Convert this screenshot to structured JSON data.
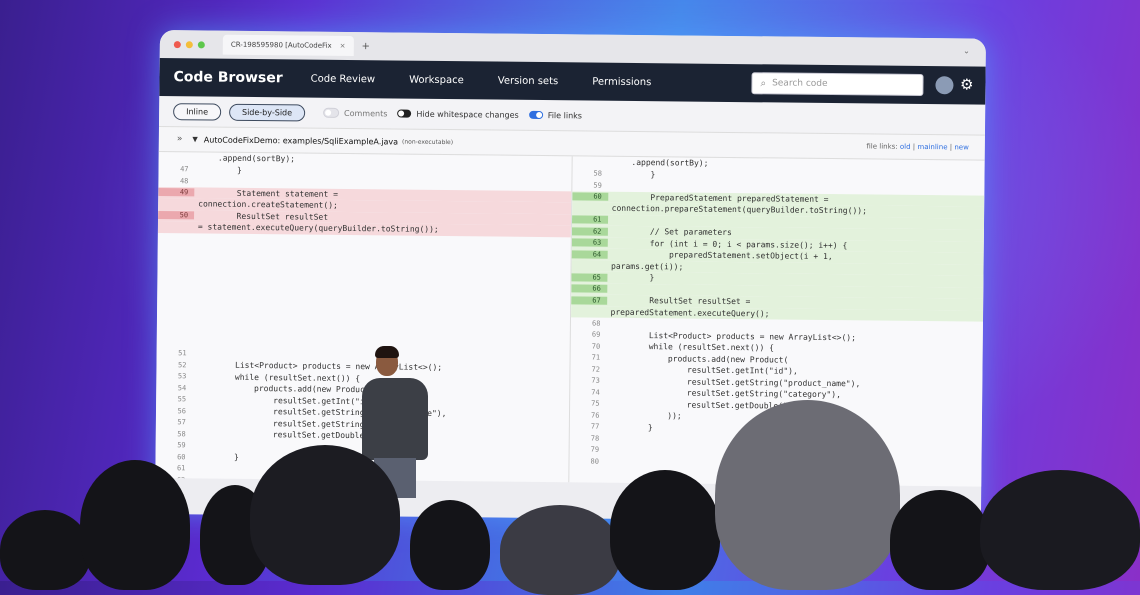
{
  "browser": {
    "tab_title": "CR-198595980 [AutoCodeFix",
    "tab_close": "×",
    "new_tab": "+",
    "menu_chevron": "⌄"
  },
  "nav": {
    "brand": "Code Browser",
    "links": [
      "Code Review",
      "Workspace",
      "Version sets",
      "Permissions"
    ],
    "search_placeholder": "Search code"
  },
  "toolbar": {
    "inline_label": "Inline",
    "side_by_side_label": "Side-by-Side",
    "comments_label": "Comments",
    "hide_whitespace_label": "Hide whitespace changes",
    "file_links_label": "File links"
  },
  "file": {
    "name": "AutoCodeFixDemo: examples/SqliExampleA.java",
    "meta": "(non-executable)",
    "links_prefix": "file links:",
    "link_old": "old",
    "link_mainline": "mainline",
    "link_new": "new",
    "sep": "|"
  },
  "diff": {
    "left": [
      {
        "n": "",
        "t": "    .append(sortBy);",
        "k": ""
      },
      {
        "n": "47",
        "t": "        }",
        "k": ""
      },
      {
        "n": "48",
        "t": "",
        "k": ""
      },
      {
        "n": "49",
        "t": "        Statement statement =",
        "k": "del"
      },
      {
        "n": "",
        "t": "connection.createStatement();",
        "k": "del"
      },
      {
        "n": "50",
        "t": "        ResultSet resultSet",
        "k": "del"
      },
      {
        "n": "",
        "t": "= statement.executeQuery(queryBuilder.toString());",
        "k": "del"
      },
      {
        "n": "",
        "t": "",
        "k": ""
      },
      {
        "n": "",
        "t": "",
        "k": ""
      },
      {
        "n": "",
        "t": "",
        "k": ""
      },
      {
        "n": "",
        "t": "",
        "k": ""
      },
      {
        "n": "",
        "t": "",
        "k": ""
      },
      {
        "n": "",
        "t": "",
        "k": ""
      },
      {
        "n": "",
        "t": "",
        "k": ""
      },
      {
        "n": "",
        "t": "",
        "k": ""
      },
      {
        "n": "",
        "t": "",
        "k": ""
      },
      {
        "n": "",
        "t": "",
        "k": ""
      },
      {
        "n": "51",
        "t": "",
        "k": ""
      },
      {
        "n": "52",
        "t": "        List<Product> products = new ArrayList<>();",
        "k": ""
      },
      {
        "n": "53",
        "t": "        while (resultSet.next()) {",
        "k": ""
      },
      {
        "n": "54",
        "t": "            products.add(new Product(",
        "k": ""
      },
      {
        "n": "55",
        "t": "                resultSet.getInt(\"id\"),",
        "k": ""
      },
      {
        "n": "56",
        "t": "                resultSet.getString(\"product_name\"),",
        "k": ""
      },
      {
        "n": "57",
        "t": "                resultSet.getString(\"category\"),",
        "k": ""
      },
      {
        "n": "58",
        "t": "                resultSet.getDouble(\"price\")",
        "k": ""
      },
      {
        "n": "59",
        "t": "",
        "k": ""
      },
      {
        "n": "60",
        "t": "        }",
        "k": ""
      },
      {
        "n": "61",
        "t": "",
        "k": ""
      },
      {
        "n": "62",
        "t": "",
        "k": ""
      }
    ],
    "right": [
      {
        "n": "",
        "t": "    .append(sortBy);",
        "k": ""
      },
      {
        "n": "58",
        "t": "        }",
        "k": ""
      },
      {
        "n": "59",
        "t": "",
        "k": ""
      },
      {
        "n": "60",
        "t": "        PreparedStatement preparedStatement =",
        "k": "add"
      },
      {
        "n": "",
        "t": "connection.prepareStatement(queryBuilder.toString());",
        "k": "add"
      },
      {
        "n": "61",
        "t": "",
        "k": "add"
      },
      {
        "n": "62",
        "t": "        // Set parameters",
        "k": "add"
      },
      {
        "n": "63",
        "t": "        for (int i = 0; i < params.size(); i++) {",
        "k": "add"
      },
      {
        "n": "64",
        "t": "            preparedStatement.setObject(i + 1,",
        "k": "add"
      },
      {
        "n": "",
        "t": "params.get(i));",
        "k": "add"
      },
      {
        "n": "65",
        "t": "        }",
        "k": "add"
      },
      {
        "n": "66",
        "t": "",
        "k": "add"
      },
      {
        "n": "67",
        "t": "        ResultSet resultSet =",
        "k": "add"
      },
      {
        "n": "",
        "t": "preparedStatement.executeQuery();",
        "k": "add"
      },
      {
        "n": "68",
        "t": "",
        "k": ""
      },
      {
        "n": "69",
        "t": "        List<Product> products = new ArrayList<>();",
        "k": ""
      },
      {
        "n": "70",
        "t": "        while (resultSet.next()) {",
        "k": ""
      },
      {
        "n": "71",
        "t": "            products.add(new Product(",
        "k": ""
      },
      {
        "n": "72",
        "t": "                resultSet.getInt(\"id\"),",
        "k": ""
      },
      {
        "n": "73",
        "t": "                resultSet.getString(\"product_name\"),",
        "k": ""
      },
      {
        "n": "74",
        "t": "                resultSet.getString(\"category\"),",
        "k": ""
      },
      {
        "n": "75",
        "t": "                resultSet.getDouble(\"price\")",
        "k": ""
      },
      {
        "n": "76",
        "t": "            ));",
        "k": ""
      },
      {
        "n": "77",
        "t": "        }",
        "k": ""
      },
      {
        "n": "78",
        "t": "",
        "k": ""
      },
      {
        "n": "79",
        "t": "",
        "k": ""
      },
      {
        "n": "80",
        "t": "",
        "k": ""
      }
    ]
  },
  "colors": {
    "nav_bg": "#1b2333",
    "deleted_bg": "#f6d9dc",
    "added_bg": "#e3f2dc",
    "accent": "#2f6fe0"
  }
}
